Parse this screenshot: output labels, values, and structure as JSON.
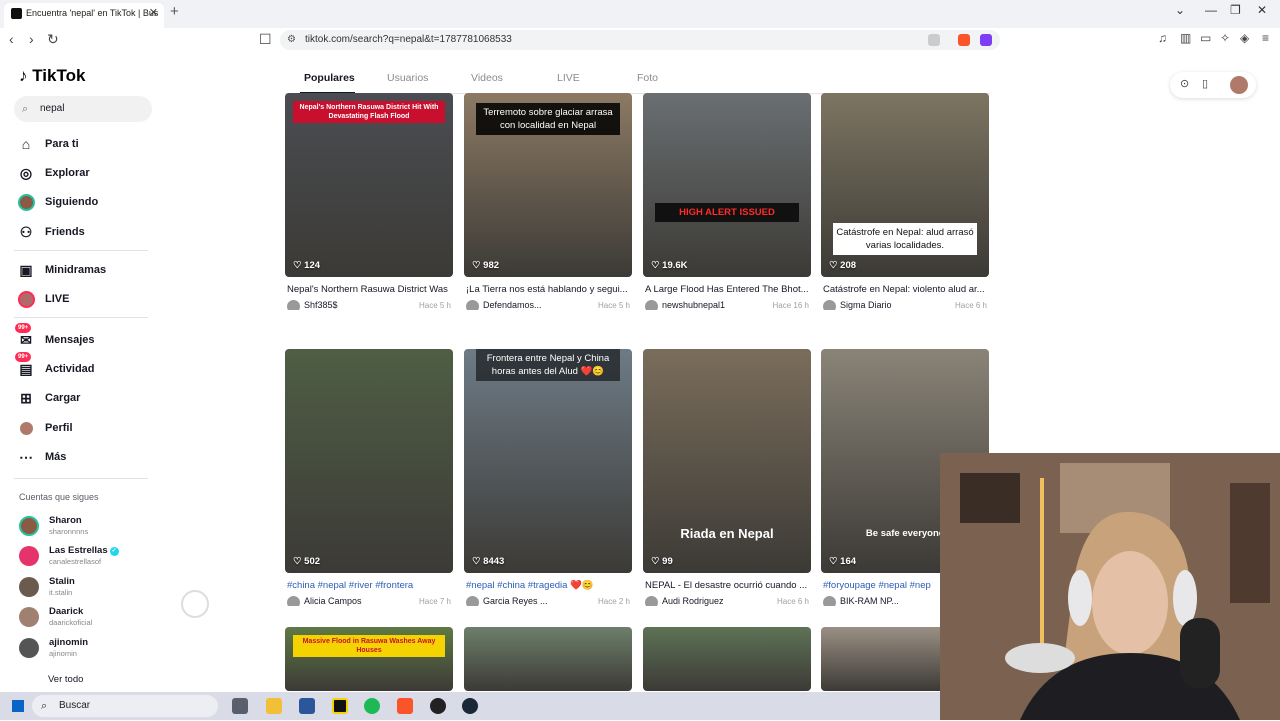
{
  "browser": {
    "tab_title": "Encuentra 'nepal' en TikTok | Bus",
    "url": "tiktok.com/search?q=nepal&t=1787781068533"
  },
  "sidebar": {
    "logo": "TikTok",
    "search_value": "nepal",
    "nav": [
      {
        "label": "Para ti",
        "icon": "home-icon"
      },
      {
        "label": "Explorar",
        "icon": "compass-icon"
      },
      {
        "label": "Siguiendo",
        "icon": "avatar"
      },
      {
        "label": "Friends",
        "icon": "friends-icon"
      },
      {
        "label": "Minidramas",
        "icon": "film-icon"
      },
      {
        "label": "LIVE",
        "icon": "avatar"
      },
      {
        "label": "Mensajes",
        "icon": "message-icon",
        "badge": "99+"
      },
      {
        "label": "Actividad",
        "icon": "inbox-icon",
        "badge": "99+"
      },
      {
        "label": "Cargar",
        "icon": "plus-square-icon"
      },
      {
        "label": "Perfil",
        "icon": "avatar"
      },
      {
        "label": "Más",
        "icon": "more-icon"
      }
    ],
    "following_title": "Cuentas que sigues",
    "following": [
      {
        "name": "Sharon",
        "handle": "sharonnnns",
        "color": "#8a5a44"
      },
      {
        "name": "Las Estrellas",
        "handle": "canalestrellasof",
        "color": "#e5336b",
        "verified": true
      },
      {
        "name": "Stalin",
        "handle": "it.stalin",
        "color": "#6b5a4e"
      },
      {
        "name": "Daarick",
        "handle": "daarickoficial",
        "color": "#a08070"
      },
      {
        "name": "ajinomin",
        "handle": "ajinomin",
        "color": "#555"
      }
    ],
    "see_all": "Ver todo"
  },
  "search_tabs": [
    "Populares",
    "Usuarios",
    "Videos",
    "LIVE",
    "Foto"
  ],
  "videos": [
    {
      "likes": "124",
      "title": "Nepal's Northern Rasuwa District Was",
      "author": "Shf385$",
      "time": "Hace 5 h",
      "tag": false,
      "overlay": "Nepal's Northern Rasuwa District Hit With Devastating Flash Flood",
      "bg": "#4a4d52"
    },
    {
      "likes": "982",
      "title": "¡La Tierra nos está hablando y segui...",
      "author": "Defendamos...",
      "time": "Hace 5 h",
      "tag": false,
      "overlay": "Terremoto sobre glaciar arrasa con localidad en Nepal",
      "bg": "#8c7a64"
    },
    {
      "likes": "19.6K",
      "title": "A Large Flood Has Entered The Bhot...",
      "author": "newshubnepal1",
      "time": "Hace 16 h",
      "tag": false,
      "overlay": "HIGH ALERT ISSUED",
      "bg": "#6a6f72"
    },
    {
      "likes": "208",
      "title": "Catástrofe en Nepal: violento alud ar...",
      "author": "Sigma Diario",
      "time": "Hace 6 h",
      "tag": false,
      "overlay": "Catástrofe en Nepal: alud arrasó varias localidades.",
      "bg": "#7d7562"
    },
    {
      "likes": "502",
      "title": "#china #nepal #river #frontera",
      "author": "Alicia Campos",
      "time": "Hace 7 h",
      "tag": true,
      "overlay": "",
      "bg": "#4f5e45"
    },
    {
      "likes": "8443",
      "title": "#nepal #china #tragedia ❤️😊",
      "author": "Garcia Reyes ...",
      "time": "Hace 2 h",
      "tag": true,
      "overlay": "Frontera entre Nepal y China horas antes del Alud ❤️😊",
      "bg": "#6d7b86"
    },
    {
      "likes": "99",
      "title": "NEPAL - El desastre ocurrió cuando ...",
      "author": "Audi Rodriguez",
      "time": "Hace 6 h",
      "tag": false,
      "overlay": "Riada en Nepal",
      "bg": "#7a6d5b"
    },
    {
      "likes": "164",
      "title": "#foryoupage #nepal #nep",
      "author": "BIK-RAM NP...",
      "time": "",
      "tag": true,
      "overlay": "Be safe everyone",
      "bg": "#8a8478"
    },
    {
      "likes": "",
      "title": "",
      "author": "",
      "time": "",
      "tag": false,
      "overlay": "Massive Flood in Rasuwa Washes Away Houses",
      "bg": "#5f7a45"
    },
    {
      "likes": "",
      "title": "",
      "author": "",
      "time": "",
      "tag": false,
      "overlay": "",
      "bg": "#6d7f6a"
    },
    {
      "likes": "",
      "title": "",
      "author": "",
      "time": "",
      "tag": false,
      "overlay": "",
      "bg": "#5e7356"
    },
    {
      "likes": "",
      "title": "",
      "author": "",
      "time": "",
      "tag": false,
      "overlay": "",
      "bg": "#9a8f84"
    }
  ],
  "taskbar": {
    "search_label": "Buscar"
  },
  "colors": {
    "accent": "#fe2c55",
    "tag_link": "#2b5db9"
  }
}
